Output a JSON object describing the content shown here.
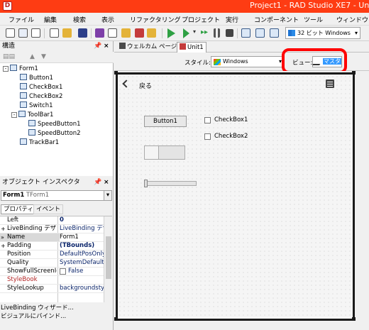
{
  "app": {
    "title": "Project1 - RAD Studio XE7 - Un"
  },
  "menu": [
    "ファイル",
    "編集",
    "検索",
    "表示",
    "リファクタリング",
    "プロジェクト",
    "実行",
    "コンポーネント",
    "ツール",
    "ウィンドウ"
  ],
  "toolbar": {
    "platform": "32 ビット Windows"
  },
  "structure": {
    "title": "構造",
    "tree": [
      {
        "label": "Form1",
        "expander": "-"
      },
      {
        "label": "Button1"
      },
      {
        "label": "CheckBox1"
      },
      {
        "label": "CheckBox2"
      },
      {
        "label": "Switch1"
      },
      {
        "label": "ToolBar1",
        "expander": "-"
      },
      {
        "label": "SpeedButton1"
      },
      {
        "label": "SpeedButton2"
      },
      {
        "label": "TrackBar1"
      }
    ]
  },
  "inspector": {
    "title": "オブジェクト インスペクタ",
    "object_name": "Form1",
    "object_class": "TForm1",
    "tabs": [
      "プロパティ",
      "イベント"
    ],
    "properties": [
      {
        "name": "Left",
        "value": "0",
        "mark": ""
      },
      {
        "name": "LiveBinding デザイ",
        "value": "LiveBinding デザ",
        "mark": "+"
      },
      {
        "name": "Name",
        "value": "Form1",
        "mark": "»"
      },
      {
        "name": "Padding",
        "value": "(TBounds)",
        "mark": "+"
      },
      {
        "name": "Position",
        "value": "DefaultPosOnly",
        "mark": ""
      },
      {
        "name": "Quality",
        "value": "SystemDefault",
        "mark": ""
      },
      {
        "name": "ShowFullScreenIco",
        "value": "False",
        "mark": ""
      },
      {
        "name": "StyleBook",
        "value": "",
        "mark": ""
      },
      {
        "name": "StyleLookup",
        "value": "backgroundstyle",
        "mark": ""
      }
    ],
    "footer": [
      "LiveBinding ウィザード...",
      "ビジュアルにバインド..."
    ]
  },
  "doc_tabs": [
    "ウェルカム ページ",
    "Unit1"
  ],
  "style_bar": {
    "style_label": "スタイル:",
    "style_value": "Windows",
    "view_label": "ビュー:",
    "view_value": "マスタ"
  },
  "form": {
    "back_label": "戻る",
    "button1": "Button1",
    "checkbox1": "CheckBox1",
    "checkbox2": "CheckBox2"
  },
  "colors": {
    "titlebar": "#fe3c13",
    "highlight": "#ff0000",
    "accent": "#3399ff"
  }
}
